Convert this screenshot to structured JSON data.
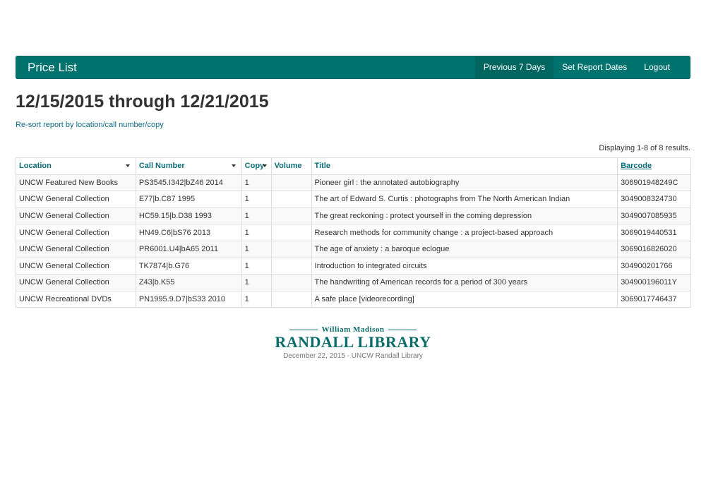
{
  "navbar": {
    "brand": "Price List",
    "links": [
      "Previous 7 Days",
      "Set Report Dates",
      "Logout"
    ]
  },
  "heading": "12/15/2015 through 12/21/2015",
  "resort_link": "Re-sort report by location/call number/copy",
  "results_count": "Displaying 1-8 of 8 results.",
  "table": {
    "headers": [
      "Location",
      "Call Number",
      "Copy",
      "Volume",
      "Title",
      "Barcode"
    ],
    "rows": [
      [
        "UNCW Featured New Books",
        "PS3545.I342|bZ46 2014",
        "1",
        "",
        "Pioneer girl : the annotated autobiography",
        "306901948249C"
      ],
      [
        "UNCW General Collection",
        "E77|b.C87 1995",
        "1",
        "",
        "The art of Edward S. Curtis : photographs from The North American Indian",
        "3049008324730"
      ],
      [
        "UNCW General Collection",
        "HC59.15|b.D38 1993",
        "1",
        "",
        "The great reckoning : protect yourself in the coming depression",
        "3049007085935"
      ],
      [
        "UNCW General Collection",
        "HN49.C6|bS76 2013",
        "1",
        "",
        "Research methods for community change : a project-based approach",
        "3069019440531"
      ],
      [
        "UNCW General Collection",
        "PR6001.U4|bA65 2011",
        "1",
        "",
        "The age of anxiety : a baroque eclogue",
        "3069016826020"
      ],
      [
        "UNCW General Collection",
        "TK7874|b.G76",
        "1",
        "",
        "Introduction to integrated circuits",
        "304900201766"
      ],
      [
        "UNCW General Collection",
        "Z43|b.K55",
        "1",
        "",
        "The handwriting of American records for a period of 300 years",
        "304900196011Y"
      ],
      [
        "UNCW Recreational DVDs",
        "PN1995.9.D7|bS33 2010",
        "1",
        "",
        "A safe place [videorecording]",
        "3069017746437"
      ]
    ]
  },
  "footer": {
    "logo_top": "William Madison",
    "logo_main": "RANDALL LIBRARY",
    "text": "December 22, 2015 - UNCW Randall Library"
  },
  "colors": {
    "navbar": "#00736e",
    "link": "#0e6b82",
    "header_text": "#0b6e77"
  }
}
